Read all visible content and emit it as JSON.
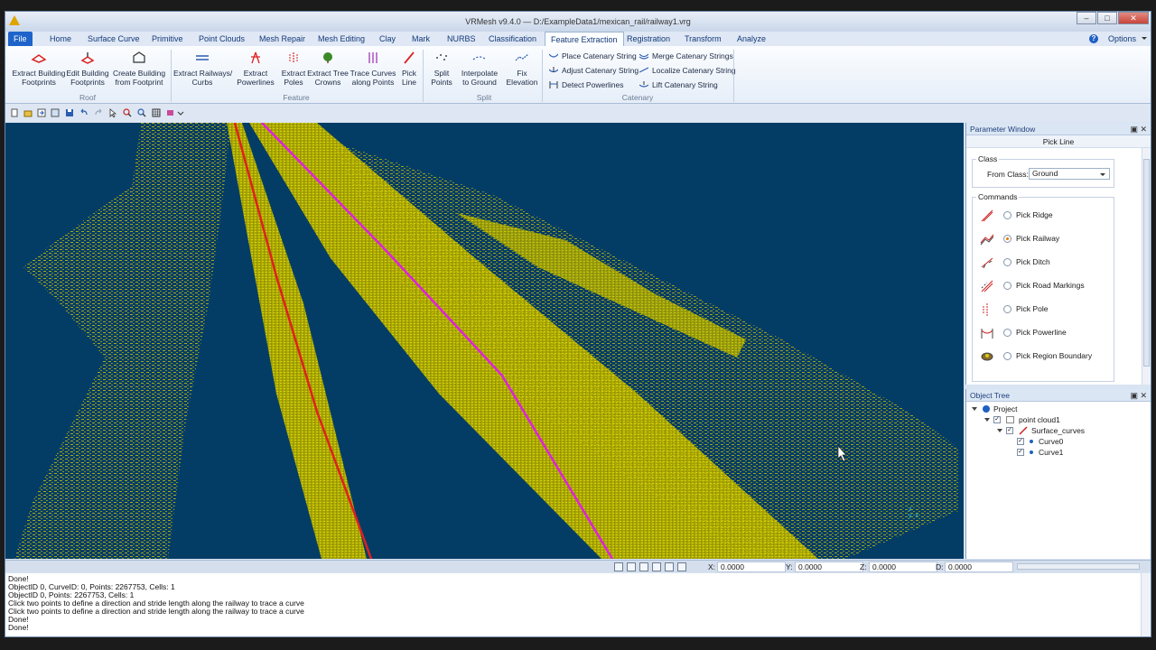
{
  "window": {
    "title": "VRMesh v9.4.0 — D:/ExampleData1/mexican_rail/railway1.vrg"
  },
  "tabs": [
    "File",
    "Home",
    "Surface Curve",
    "Primitive",
    "Point Clouds",
    "Mesh Repair",
    "Mesh Editing",
    "Clay",
    "Mark",
    "NURBS",
    "Classification",
    "Feature Extraction",
    "Registration",
    "Transform",
    "Analyze"
  ],
  "options_label": "Options",
  "ribbon": {
    "roof": {
      "group": "Roof",
      "b1": "Extract Building\nFootprints",
      "b2": "Edit Building\nFootprints",
      "b3": "Create Building\nfrom Footprint"
    },
    "feature": {
      "group": "Feature",
      "b1": "Extract Railways/\nCurbs",
      "b2": "Extract\nPowerlines",
      "b3": "Extract\nPoles",
      "b4": "Extract Tree\nCrowns",
      "b5": "Trace Curves\nalong Points",
      "b6": "Pick\nLine"
    },
    "split": {
      "group": "Split",
      "b1": "Split\nPoints",
      "b2": "Interpolate\nto Ground",
      "b3": "Fix\nElevation"
    },
    "catenary": {
      "group": "Catenary",
      "s1": "Place Catenary String",
      "s2": "Adjust Catenary String",
      "s3": "Detect Powerlines",
      "s4": "Merge Catenary Strings",
      "s5": "Localize Catenary String",
      "s6": "Lift Catenary String"
    }
  },
  "parameter_window": {
    "title": "Parameter Window",
    "subtitle": "Pick Line",
    "class_legend": "Class",
    "from_class_label": "From Class:",
    "from_class_value": "Ground",
    "commands_legend": "Commands",
    "commands": [
      "Pick Ridge",
      "Pick Railway",
      "Pick Ditch",
      "Pick Road Markings",
      "Pick Pole",
      "Pick Powerline",
      "Pick Region Boundary"
    ],
    "selected_command": "Pick Railway"
  },
  "object_tree": {
    "title": "Object Tree",
    "project": "Project",
    "cloud": "point cloud1",
    "group": "Surface_curves",
    "curves": [
      "Curve0",
      "Curve1"
    ]
  },
  "status": {
    "x_label": "X:",
    "x": "0.0000",
    "y_label": "Y:",
    "y": "0.0000",
    "z_label": "Z:",
    "z": "0.0000",
    "d_label": "D:",
    "d": "0.0000"
  },
  "log": [
    "Done!",
    "ObjectID 0, CurveID: 0, Points: 2267753, Cells: 1",
    "ObjectID 0, Points: 2267753, Cells: 1",
    "Click two points to define a direction and stride length along the railway to trace a curve",
    "Click two points to define a direction and stride length along the railway to trace a curve",
    "Done!",
    "Done!"
  ],
  "colors": {
    "viewport_bg": "#033d66",
    "point_cloud": "#c8c000",
    "rail_curve_red": "#e02020",
    "rail_curve_magenta": "#e020e0"
  }
}
